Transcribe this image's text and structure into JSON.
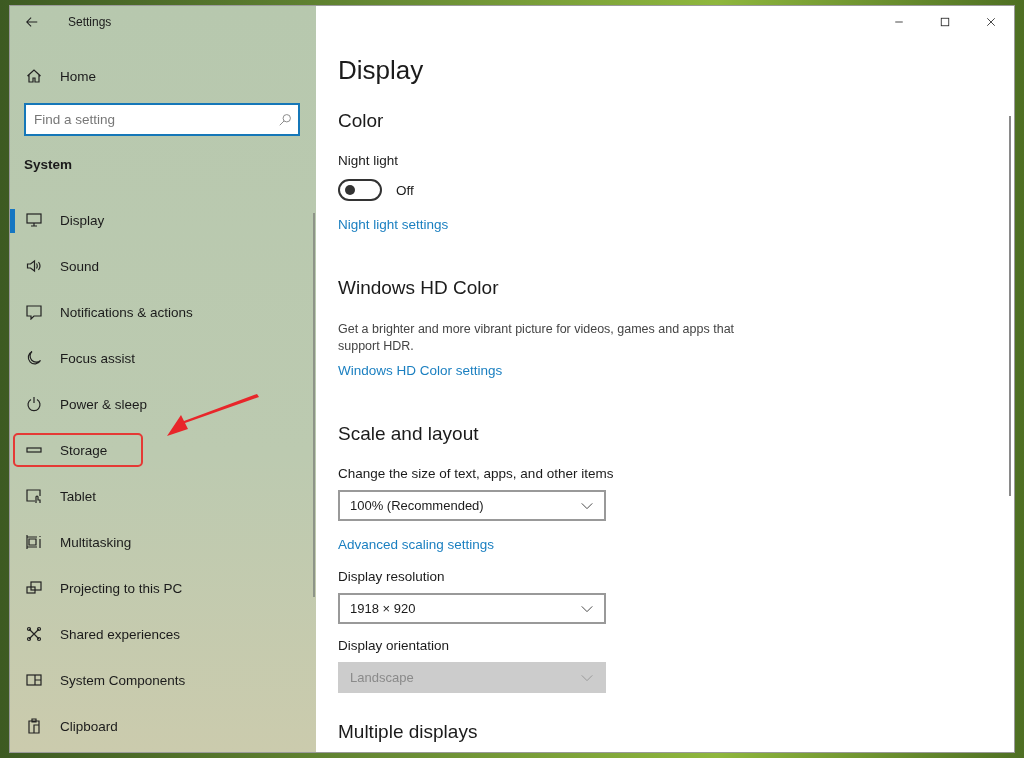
{
  "window": {
    "title": "Settings"
  },
  "sidebar": {
    "home": "Home",
    "search": {
      "placeholder": "Find a setting"
    },
    "group": "System",
    "items": [
      {
        "label": "Display",
        "selected": true,
        "highlighted": false
      },
      {
        "label": "Sound",
        "selected": false,
        "highlighted": false
      },
      {
        "label": "Notifications & actions",
        "selected": false,
        "highlighted": false
      },
      {
        "label": "Focus assist",
        "selected": false,
        "highlighted": false
      },
      {
        "label": "Power & sleep",
        "selected": false,
        "highlighted": false
      },
      {
        "label": "Storage",
        "selected": false,
        "highlighted": true
      },
      {
        "label": "Tablet",
        "selected": false,
        "highlighted": false
      },
      {
        "label": "Multitasking",
        "selected": false,
        "highlighted": false
      },
      {
        "label": "Projecting to this PC",
        "selected": false,
        "highlighted": false
      },
      {
        "label": "Shared experiences",
        "selected": false,
        "highlighted": false
      },
      {
        "label": "System Components",
        "selected": false,
        "highlighted": false
      },
      {
        "label": "Clipboard",
        "selected": false,
        "highlighted": false
      }
    ]
  },
  "page": {
    "title": "Display",
    "sections": [
      {
        "heading": "Color",
        "items": [
          {
            "kind": "toggle",
            "label": "Night light",
            "on": false,
            "state_text": "Off"
          },
          {
            "kind": "link",
            "text": "Night light settings"
          }
        ]
      },
      {
        "heading": "Windows HD Color",
        "items": [
          {
            "kind": "text",
            "text": "Get a brighter and more vibrant picture for videos, games and apps that support HDR."
          },
          {
            "kind": "link",
            "text": "Windows HD Color settings"
          }
        ]
      },
      {
        "heading": "Scale and layout",
        "items": [
          {
            "kind": "dropdown",
            "label": "Change the size of text, apps, and other items",
            "value": "100% (Recommended)",
            "disabled": false
          },
          {
            "kind": "link",
            "text": "Advanced scaling settings"
          },
          {
            "kind": "dropdown",
            "label": "Display resolution",
            "value": "1918 × 920",
            "disabled": false
          },
          {
            "kind": "dropdown",
            "label": "Display orientation",
            "value": "Landscape",
            "disabled": true
          }
        ]
      },
      {
        "heading": "Multiple displays"
      }
    ]
  }
}
